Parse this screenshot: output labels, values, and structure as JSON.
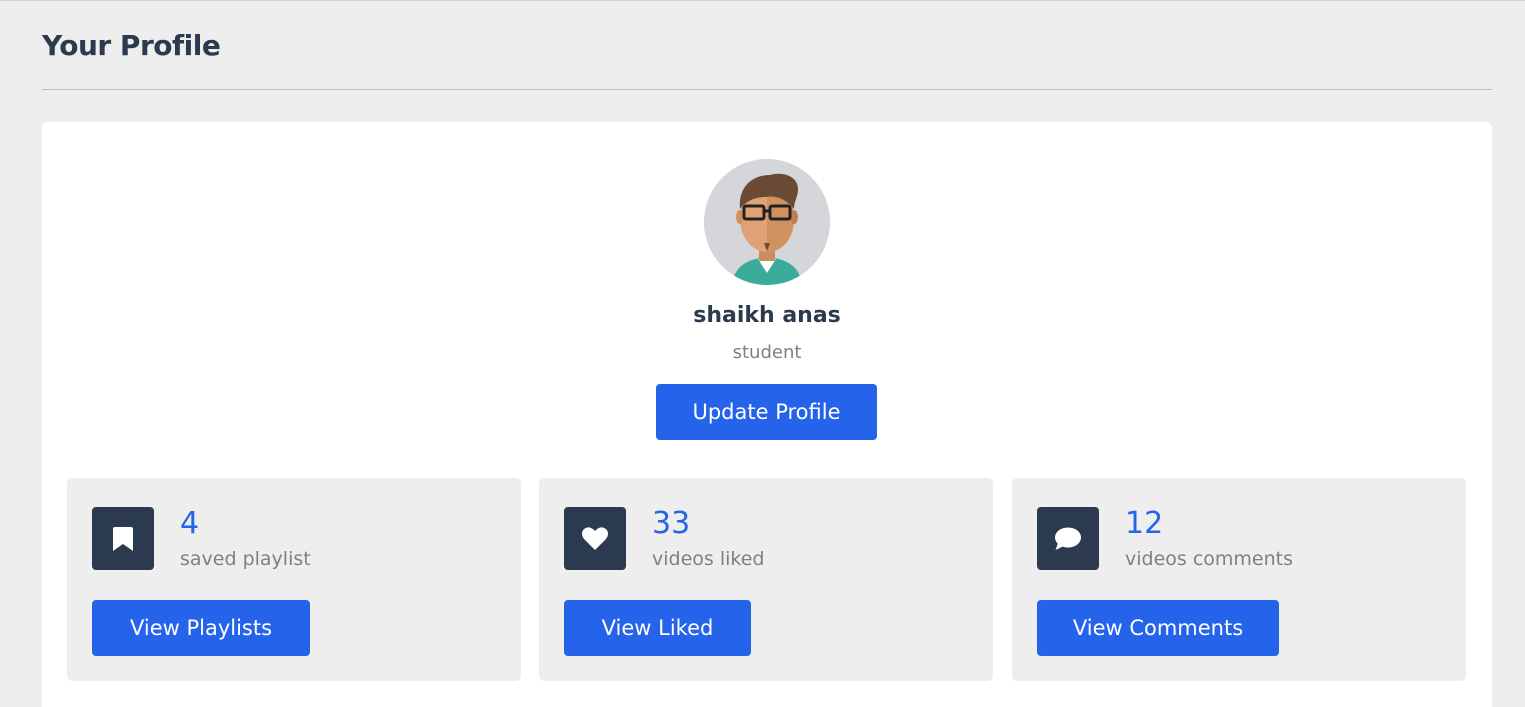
{
  "page": {
    "title": "Your Profile"
  },
  "profile": {
    "name": "shaikh anas",
    "role": "student",
    "update_button": "Update Profile",
    "avatar_icon": "male-avatar-with-glasses"
  },
  "stats": [
    {
      "icon": "bookmark-icon",
      "count": "4",
      "label": "saved playlist",
      "button": "View Playlists"
    },
    {
      "icon": "heart-icon",
      "count": "33",
      "label": "videos liked",
      "button": "View Liked"
    },
    {
      "icon": "comment-icon",
      "count": "12",
      "label": "videos comments",
      "button": "View Comments"
    }
  ],
  "colors": {
    "accent": "#2563eb",
    "dark": "#2c3a4f",
    "muted": "#808080",
    "background": "#eeeeee",
    "card": "#ffffff"
  }
}
